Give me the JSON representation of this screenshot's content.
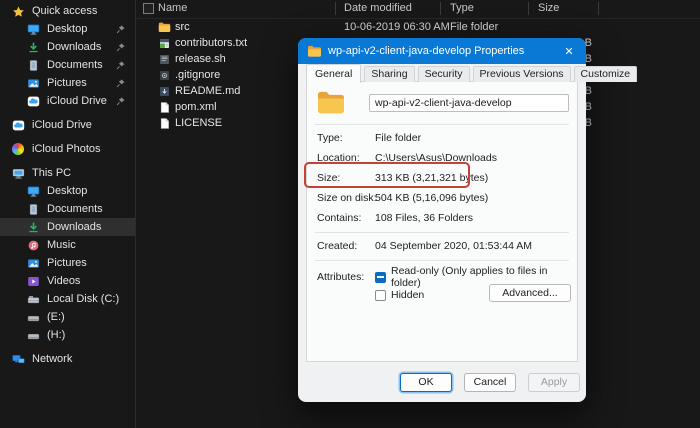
{
  "explorer": {
    "sidebar": {
      "sections": [
        {
          "label": "Quick access",
          "icon": "star-icon",
          "children": [
            {
              "label": "Desktop",
              "icon": "monitor-icon",
              "pinned": true
            },
            {
              "label": "Downloads",
              "icon": "download-icon",
              "pinned": true
            },
            {
              "label": "Documents",
              "icon": "document-icon",
              "pinned": true
            },
            {
              "label": "Pictures",
              "icon": "pictures-icon",
              "pinned": true
            },
            {
              "label": "iCloud Drive",
              "icon": "cloud-icon",
              "pinned": true
            }
          ]
        },
        {
          "label": "iCloud Drive",
          "icon": "cloud-icon",
          "children": []
        },
        {
          "label": "iCloud Photos",
          "icon": "photos-icon",
          "children": []
        },
        {
          "label": "This PC",
          "icon": "computer-icon",
          "children": [
            {
              "label": "Desktop",
              "icon": "monitor-icon"
            },
            {
              "label": "Documents",
              "icon": "document-icon"
            },
            {
              "label": "Downloads",
              "icon": "download-icon",
              "selected": true
            },
            {
              "label": "Music",
              "icon": "music-icon"
            },
            {
              "label": "Pictures",
              "icon": "pictures-icon"
            },
            {
              "label": "Videos",
              "icon": "videos-icon"
            },
            {
              "label": "Local Disk (C:)",
              "icon": "disk-icon"
            },
            {
              "label": "(E:)",
              "icon": "drive-icon"
            },
            {
              "label": "(H:)",
              "icon": "drive-icon"
            }
          ]
        },
        {
          "label": "Network",
          "icon": "network-icon",
          "children": []
        }
      ]
    },
    "file_list": {
      "columns": [
        "Name",
        "Date modified",
        "Type",
        "Size"
      ],
      "rows": [
        {
          "name": "src",
          "icon": "folder-icon",
          "date_modified": "10-06-2019 06:30 AM",
          "type": "File folder",
          "size": ""
        },
        {
          "name": "contributors.txt",
          "icon": "text-file-icon",
          "size_visible_fragment": "B"
        },
        {
          "name": "release.sh",
          "icon": "script-file-icon",
          "size_visible_fragment": "B"
        },
        {
          "name": ".gitignore",
          "icon": "git-file-icon",
          "size_visible_fragment": "B"
        },
        {
          "name": "README.md",
          "icon": "markdown-file-icon",
          "size_visible_fragment": "B"
        },
        {
          "name": "pom.xml",
          "icon": "xml-file-icon",
          "size_visible_fragment": "B"
        },
        {
          "name": "LICENSE",
          "icon": "file-icon",
          "size_visible_fragment": "B"
        }
      ]
    }
  },
  "dialog": {
    "title": "wp-api-v2-client-java-develop Properties",
    "close_glyph": "✕",
    "tabs": [
      {
        "label": "General",
        "active": true
      },
      {
        "label": "Sharing"
      },
      {
        "label": "Security"
      },
      {
        "label": "Previous Versions"
      },
      {
        "label": "Customize"
      }
    ],
    "name_field": "wp-api-v2-client-java-develop",
    "details": [
      {
        "label": "Type:",
        "value": "File folder"
      },
      {
        "label": "Location:",
        "value": "C:\\Users\\Asus\\Downloads"
      },
      {
        "label": "Size:",
        "value": "313 KB (3,21,321 bytes)",
        "highlighted": true
      },
      {
        "label": "Size on disk:",
        "value": "504 KB (5,16,096 bytes)"
      },
      {
        "label": "Contains:",
        "value": "108 Files, 36 Folders"
      },
      {
        "label": "Created:",
        "value": "04 September 2020, 01:53:44 AM"
      }
    ],
    "attributes": {
      "label": "Attributes:",
      "readonly": {
        "label": "Read-only (Only applies to files in folder)",
        "state": "indeterminate"
      },
      "hidden": {
        "label": "Hidden",
        "state": "unchecked"
      },
      "advanced_button": "Advanced..."
    },
    "footer_buttons": [
      {
        "label": "OK",
        "focused": true
      },
      {
        "label": "Cancel"
      },
      {
        "label": "Apply",
        "disabled": true
      }
    ],
    "colors": {
      "titlebar": "#0a79d6",
      "size_highlight": "#c4423b",
      "sidebar_selection": "#2f2f2f"
    }
  }
}
